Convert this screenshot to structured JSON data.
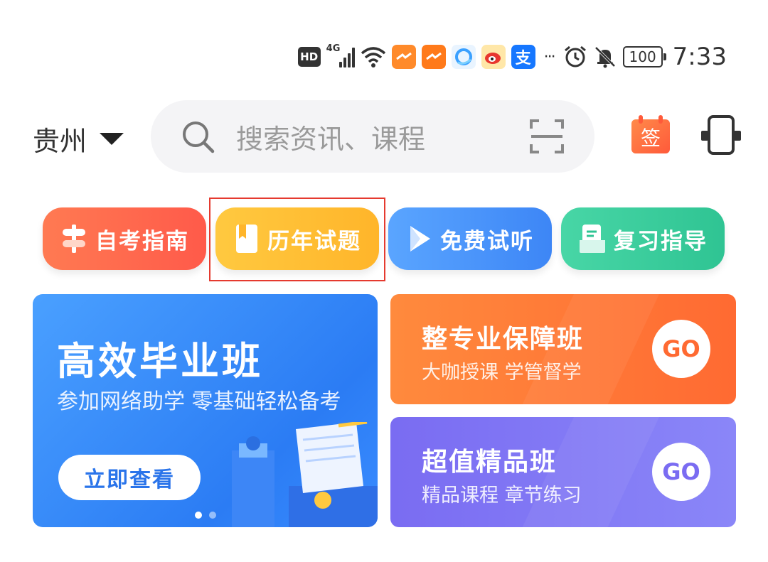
{
  "status_bar": {
    "hd": "HD",
    "network": "4G",
    "battery": "100",
    "time": "7:33",
    "more": "···",
    "apps": [
      {
        "name": "app-orange-1-icon",
        "color": "#ff8a2a"
      },
      {
        "name": "app-orange-2-icon",
        "color": "#ff7a1a"
      },
      {
        "name": "app-qq-browser-icon",
        "color": "#3aa0ff"
      },
      {
        "name": "app-weibo-icon",
        "color": "#ffb020"
      },
      {
        "name": "app-alipay-icon",
        "color": "#1677ff"
      }
    ]
  },
  "header": {
    "city": "贵州",
    "search_placeholder": "搜索资讯、课程",
    "sign_label": "签"
  },
  "quick_nav": [
    {
      "label": "自考指南",
      "icon": "signpost-icon"
    },
    {
      "label": "历年试题",
      "icon": "bookmark-book-icon"
    },
    {
      "label": "免费试听",
      "icon": "play-icon"
    },
    {
      "label": "复习指导",
      "icon": "document-icon"
    }
  ],
  "banner_main": {
    "title": "高效毕业班",
    "subtitle": "参加网络助学 零基础轻松备考",
    "button": "立即查看"
  },
  "banner_cards": [
    {
      "title": "整专业保障班",
      "subtitle": "大咖授课 学管督学",
      "go": "GO"
    },
    {
      "title": "超值精品班",
      "subtitle": "精品课程 章节练习",
      "go": "GO"
    }
  ],
  "colors": {
    "accent_blue": "#2b7cf4",
    "accent_orange": "#ff6a32",
    "accent_purple": "#7a6cf2",
    "highlight_box": "#e53a2f"
  }
}
